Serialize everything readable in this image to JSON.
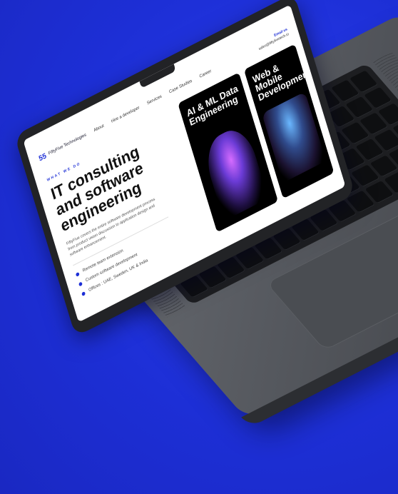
{
  "colors": {
    "background": "#1d2fd6",
    "accent": "#1d2fd6",
    "laptop": "#55585e"
  },
  "site": {
    "logo_text": "FiftyFive Technologies",
    "nav": [
      "About",
      "Hire a developer",
      "Services",
      "Case Studies",
      "Career"
    ],
    "contact_label": "Email us",
    "contact_email": "sales@fiftyfivetech.io"
  },
  "hero": {
    "eyebrow": "WHAT WE DO",
    "title": "IT consulting and software engineering",
    "description": "FiftyFive covers the entire software development process from product vision discussion to application design and software enhancement.",
    "bullets": [
      "Remote team extension",
      "Custom software development",
      "Offices : UAE, Sweden, UK & India"
    ]
  },
  "cards": [
    {
      "title": "AI & ML Data Engineering",
      "image_icon": "digital-head-image"
    },
    {
      "title": "Web & Mobile Development",
      "image_icon": "developer-laptop-image"
    }
  ]
}
